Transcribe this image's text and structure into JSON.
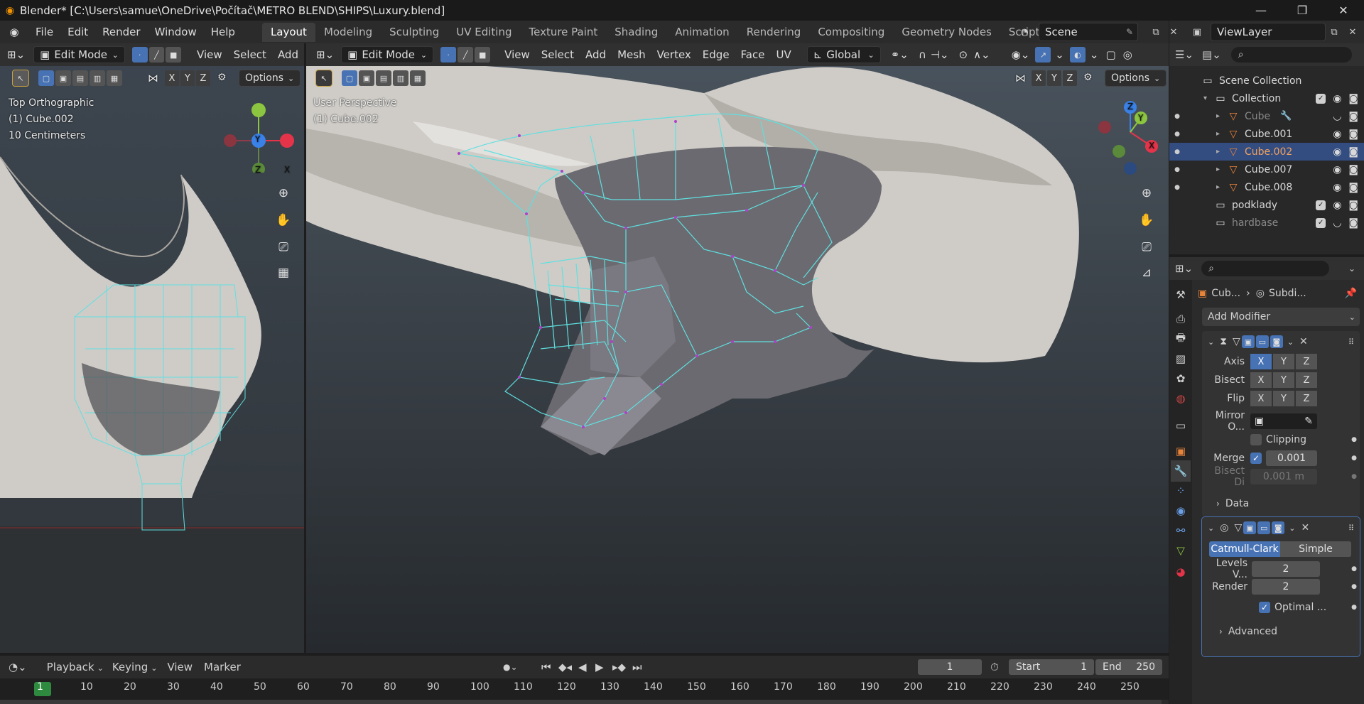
{
  "title": "Blender* [C:\\Users\\samue\\OneDrive\\Počítač\\METRO BLEND\\SHIPS\\Luxury.blend]",
  "menus": [
    "File",
    "Edit",
    "Render",
    "Window",
    "Help"
  ],
  "workspace_tabs": [
    "Layout",
    "Modeling",
    "Sculpting",
    "UV Editing",
    "Texture Paint",
    "Shading",
    "Animation",
    "Rendering",
    "Compositing",
    "Geometry Nodes",
    "Scripting"
  ],
  "active_tab": "Layout",
  "scene_name": "Scene",
  "view_layer": "ViewLayer",
  "left_viewport": {
    "mode": "Edit Mode",
    "menus": [
      "View",
      "Select",
      "Add"
    ],
    "options_label": "Options",
    "axis": [
      "X",
      "Y",
      "Z"
    ],
    "overlay_lines": [
      "Top Orthographic",
      "(1) Cube.002",
      "10 Centimeters"
    ],
    "gizmo_axes": {
      "y": "Y",
      "z": "Z",
      "x": "X"
    }
  },
  "main_viewport": {
    "mode": "Edit Mode",
    "menus": [
      "View",
      "Select",
      "Add",
      "Mesh",
      "Vertex",
      "Edge",
      "Face",
      "UV"
    ],
    "transform_orientation": "Global",
    "options_label": "Options",
    "axis": [
      "X",
      "Y",
      "Z"
    ],
    "overlay_lines": [
      "User Perspective",
      "(1) Cube.002"
    ],
    "gizmo_axes": {
      "z": "Z",
      "y": "Y",
      "x": "X"
    }
  },
  "outliner": {
    "rows": [
      {
        "label": "Scene Collection",
        "type": "scene"
      },
      {
        "label": "Collection",
        "type": "collection"
      },
      {
        "label": "Cube",
        "type": "mesh",
        "dim": true,
        "modifier": true
      },
      {
        "label": "Cube.001",
        "type": "mesh"
      },
      {
        "label": "Cube.002",
        "type": "mesh",
        "selected": true
      },
      {
        "label": "Cube.007",
        "type": "mesh"
      },
      {
        "label": "Cube.008",
        "type": "mesh"
      },
      {
        "label": "podklady",
        "type": "collection"
      },
      {
        "label": "hardbase",
        "type": "collection",
        "dim": true
      }
    ]
  },
  "properties": {
    "breadcrumb_object": "Cub...",
    "breadcrumb_modifier": "Subdi...",
    "add_modifier": "Add Modifier",
    "mirror": {
      "axis_label": "Axis",
      "bisect_label": "Bisect",
      "flip_label": "Flip",
      "axes": [
        "X",
        "Y",
        "Z"
      ],
      "mirror_object_label": "Mirror O...",
      "clipping_label": "Clipping",
      "merge_label": "Merge",
      "merge_value": "0.001",
      "bisect_distance_label": "Bisect Di",
      "bisect_distance_value": "0.001 m",
      "data_label": "Data"
    },
    "subdivision": {
      "catmull": "Catmull-Clark",
      "simple": "Simple",
      "levels_label": "Levels V...",
      "levels_value": "2",
      "render_label": "Render",
      "render_value": "2",
      "optimal_label": "Optimal ...",
      "advanced_label": "Advanced"
    }
  },
  "timeline": {
    "menus": [
      "Playback",
      "Keying",
      "View",
      "Marker"
    ],
    "current_frame": "1",
    "start_label": "Start",
    "start_value": "1",
    "end_label": "End",
    "end_value": "250",
    "ticks": [
      "1",
      "10",
      "20",
      "30",
      "40",
      "50",
      "60",
      "70",
      "80",
      "90",
      "100",
      "110",
      "120",
      "130",
      "140",
      "150",
      "160",
      "170",
      "180",
      "190",
      "200",
      "210",
      "220",
      "230",
      "240",
      "250"
    ]
  },
  "colors": {
    "accent": "#4772b3",
    "selected_row": "#334d80",
    "object_orange": "#e8833a",
    "x_red": "#e5344a",
    "y_green": "#8cc53f",
    "z_blue": "#3a82e8"
  }
}
